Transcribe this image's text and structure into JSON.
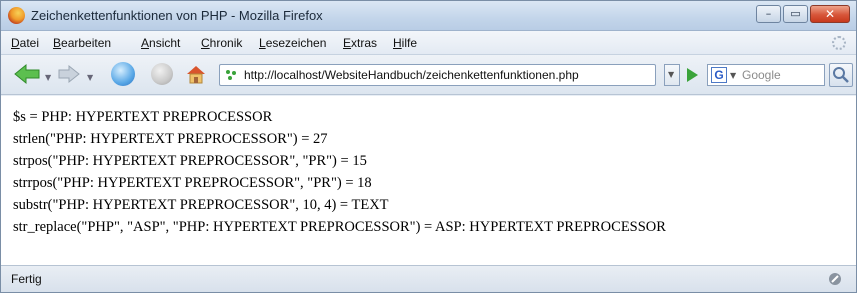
{
  "window": {
    "title": "Zeichenkettenfunktionen von PHP - Mozilla Firefox",
    "controls": {
      "minimize_glyph": "–",
      "maximize_glyph": "▭",
      "close_glyph": "✕"
    }
  },
  "menubar": {
    "items": [
      {
        "label_ul": "D",
        "label_rest": "atei"
      },
      {
        "label_ul": "B",
        "label_rest": "earbeiten"
      },
      {
        "label_ul": "A",
        "label_rest": "nsicht"
      },
      {
        "label_ul": "C",
        "label_rest": "hronik"
      },
      {
        "label_ul": "L",
        "label_rest": "esezeichen"
      },
      {
        "label_ul": "E",
        "label_rest": "xtras"
      },
      {
        "label_ul": "H",
        "label_rest": "ilfe"
      }
    ]
  },
  "navbar": {
    "url": "http://localhost/WebsiteHandbuch/zeichenkettenfunktionen.php",
    "search_placeholder": "Google",
    "search_engine_letter": "G"
  },
  "content": {
    "lines": [
      "$s = PHP: HYPERTEXT PREPROCESSOR",
      "strlen(\"PHP: HYPERTEXT PREPROCESSOR\") = 27",
      "strpos(\"PHP: HYPERTEXT PREPROCESSOR\", \"PR\") = 15",
      "strrpos(\"PHP: HYPERTEXT PREPROCESSOR\", \"PR\") = 18",
      "substr(\"PHP: HYPERTEXT PREPROCESSOR\", 10, 4) = TEXT",
      "str_replace(\"PHP\", \"ASP\", \"PHP: HYPERTEXT PREPROCESSOR\") = ASP: HYPERTEXT PREPROCESSOR"
    ]
  },
  "statusbar": {
    "text": "Fertig"
  },
  "colors": {
    "go_arrow": "#3aa33a",
    "close_button": "#d7563a",
    "nav_arrow": "#4caf50"
  }
}
